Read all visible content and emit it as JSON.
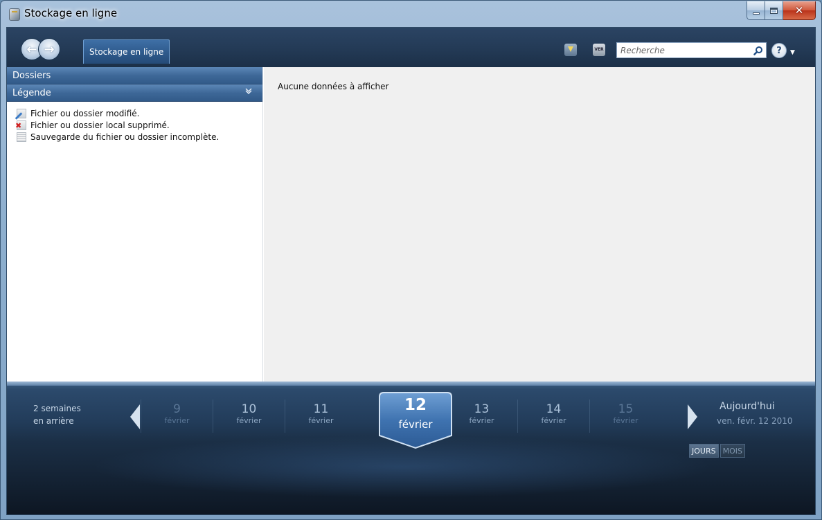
{
  "window": {
    "title": "Stockage en ligne"
  },
  "toolbar": {
    "tab_label": "Stockage en ligne",
    "search_placeholder": "Recherche",
    "vers_icon_text": "VER"
  },
  "sidebar": {
    "folders_header": "Dossiers",
    "legend_header": "Légende",
    "legend_items": [
      {
        "icon": "pencil-file-icon",
        "label": "Fichier ou dossier modifié."
      },
      {
        "icon": "deleted-file-icon",
        "label": "Fichier ou dossier local supprimé."
      },
      {
        "icon": "incomplete-file-icon",
        "label": "Sauvegarde du fichier ou dossier incomplète."
      }
    ]
  },
  "main": {
    "empty_message": "Aucune données à afficher"
  },
  "timeline": {
    "back_label_line1": "2 semaines",
    "back_label_line2": "en arrière",
    "days": [
      {
        "num": "9",
        "month": "février",
        "dim": true
      },
      {
        "num": "10",
        "month": "février",
        "dim": false
      },
      {
        "num": "11",
        "month": "février",
        "dim": false
      },
      {
        "num": "12",
        "month": "février",
        "selected": true
      },
      {
        "num": "13",
        "month": "février",
        "dim": false
      },
      {
        "num": "14",
        "month": "février",
        "dim": false
      },
      {
        "num": "15",
        "month": "février",
        "dim": true
      }
    ],
    "today_label": "Aujourd'hui",
    "today_date": "ven. févr. 12 2010",
    "mode_days": "JOURS",
    "mode_months": "MOIS"
  },
  "colors": {
    "nav_bg": "#243b57",
    "panel_header": "#3e6898",
    "timeline_bg": "#1b2f46",
    "selected_day": "#3f73b0"
  }
}
